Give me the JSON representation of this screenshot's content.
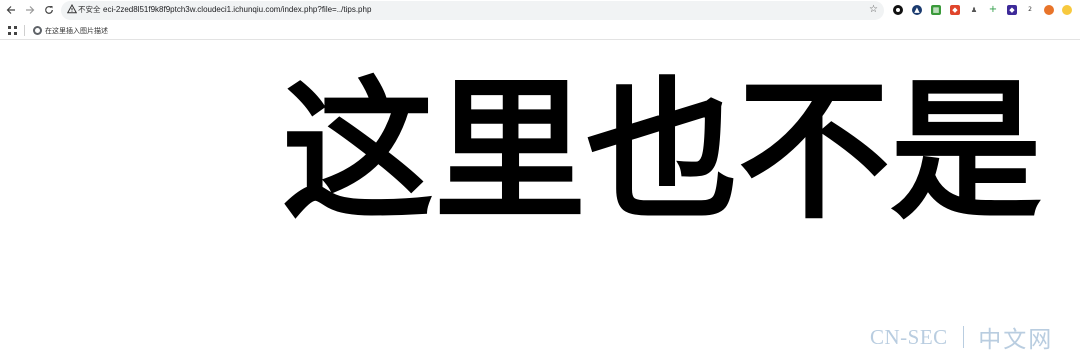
{
  "browser": {
    "back_icon": "arrow-left-icon",
    "forward_icon": "arrow-right-icon",
    "reload_icon": "reload-icon",
    "security_warning": "不安全",
    "url": "eci-2zed8l51f9k8f9ptch3w.cloudeci1.ichunqiu.com/index.php?file=../tips.php",
    "bookmark_icon": "star-icon",
    "extensions": [
      "circle-ext-icon",
      "triangle-ext-icon",
      "grid-ext-icon",
      "red-ext-icon",
      "person-ext-icon",
      "plus-ext-icon",
      "purple-ext-icon",
      "counter-ext-icon",
      "fox-ext-icon",
      "clock-ext-icon"
    ],
    "extension_counter_text": "2"
  },
  "bookmarks_bar": {
    "apps_icon": "apps-grid-icon",
    "items": [
      {
        "label": "在这里插入图片描述",
        "icon": "globe-icon"
      }
    ]
  },
  "main": {
    "headline": "这里也不是"
  },
  "watermark": {
    "left": "CN-SEC",
    "right": "中文网"
  },
  "colors": {
    "omnibox_bg": "#f1f3f4",
    "headline": "#000000",
    "watermark": "#b9cde0"
  }
}
